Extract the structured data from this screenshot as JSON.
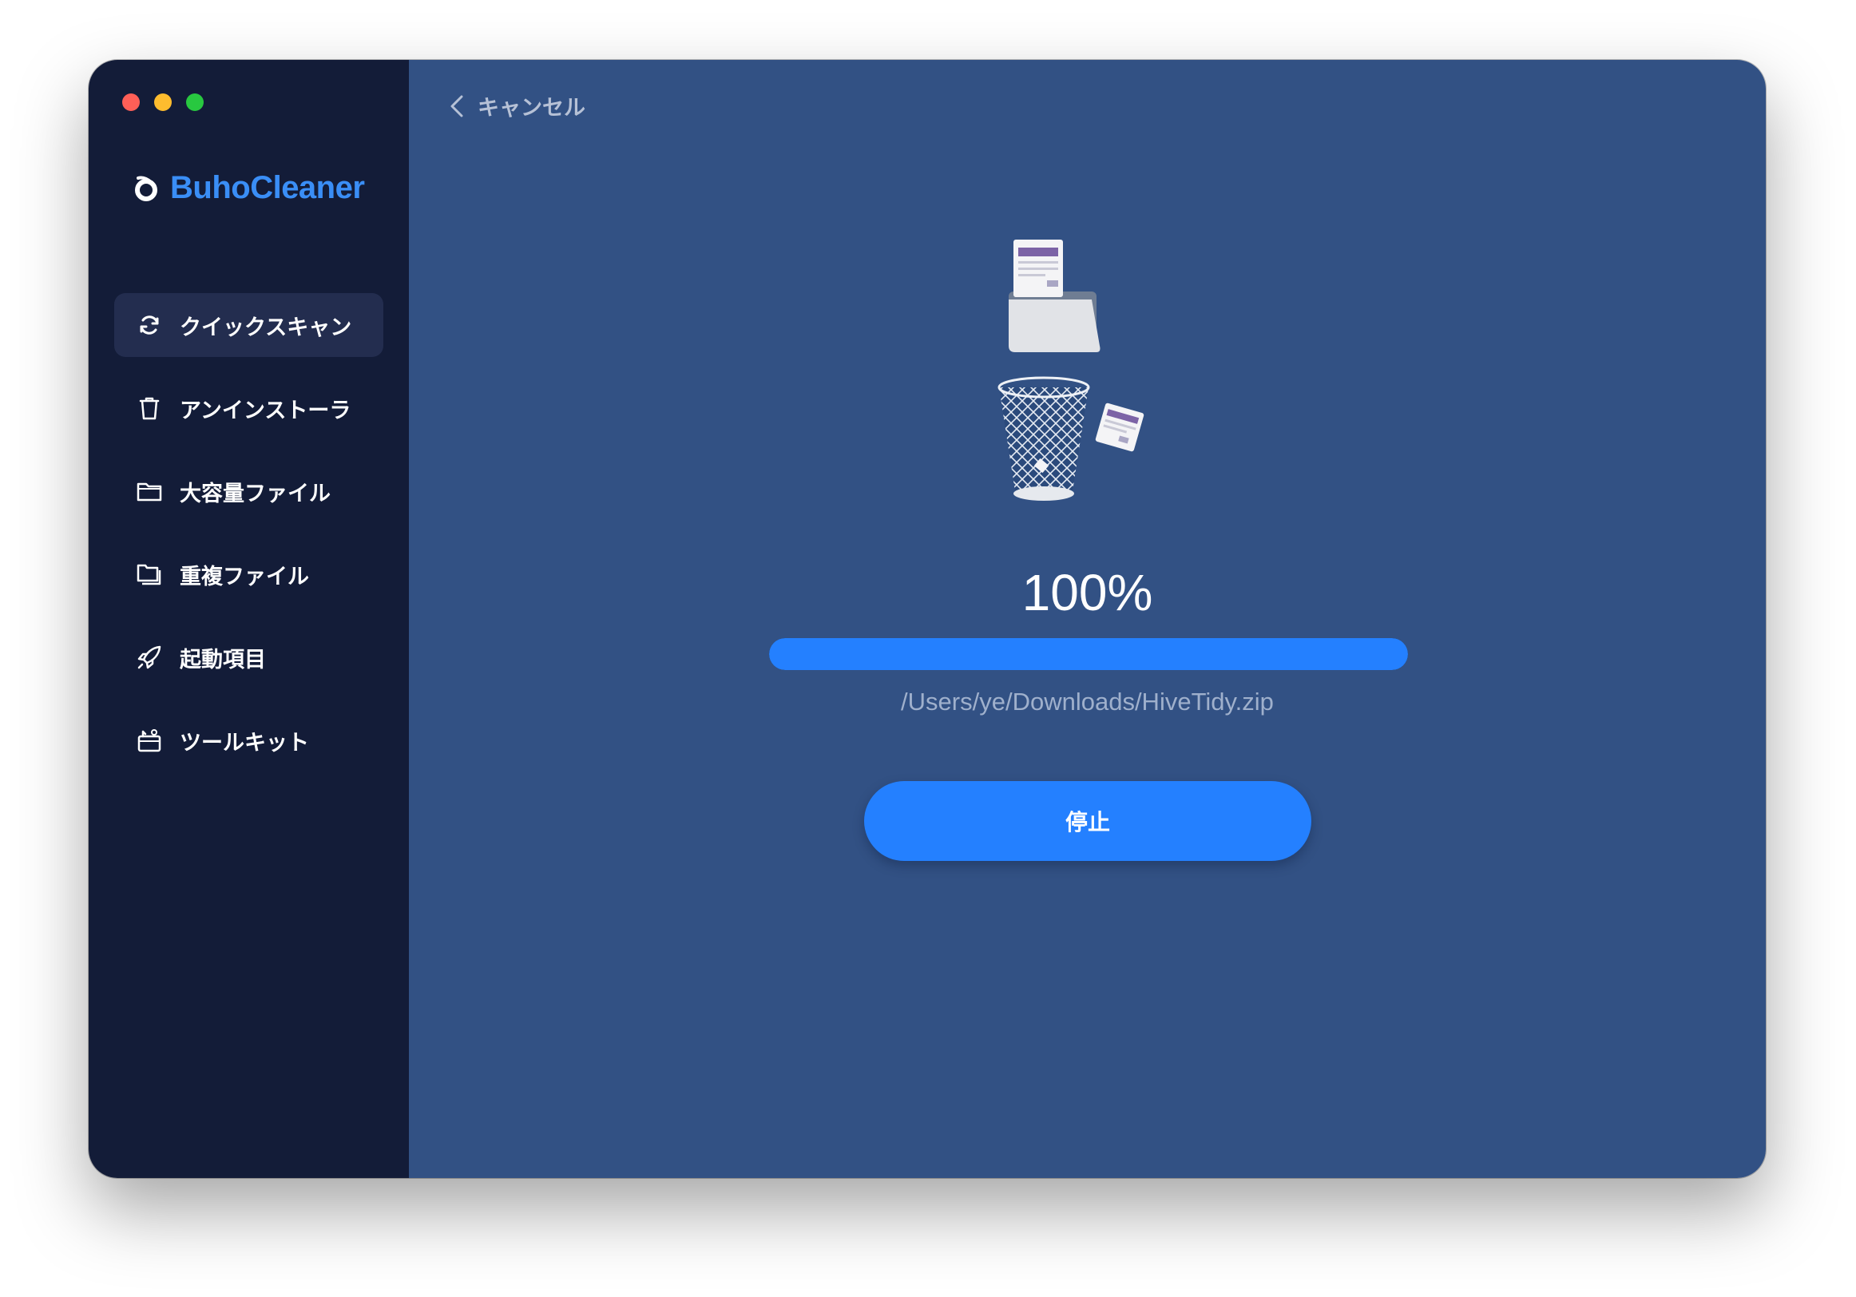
{
  "app": {
    "name": "BuhoCleaner"
  },
  "colors": {
    "sidebar_bg": "#131c38",
    "main_bg": "#325184",
    "accent": "#2480ff",
    "brand": "#3a8ef6"
  },
  "window_controls": [
    "close",
    "minimize",
    "zoom"
  ],
  "sidebar": {
    "items": [
      {
        "label": "クイックスキャン",
        "icon": "refresh-icon",
        "active": true
      },
      {
        "label": "アンインストーラ",
        "icon": "trash-icon",
        "active": false
      },
      {
        "label": "大容量ファイル",
        "icon": "folder-icon",
        "active": false
      },
      {
        "label": "重複ファイル",
        "icon": "duplicate-folder-icon",
        "active": false
      },
      {
        "label": "起動項目",
        "icon": "rocket-icon",
        "active": false
      },
      {
        "label": "ツールキット",
        "icon": "toolkit-icon",
        "active": false
      }
    ]
  },
  "header": {
    "back_label": "キャンセル",
    "back_icon": "chevron-left-icon"
  },
  "progress": {
    "percent_text": "100%",
    "value": 1.0,
    "current_file": "/Users/ye/Downloads/HiveTidy.zip"
  },
  "actions": {
    "stop_label": "停止"
  }
}
